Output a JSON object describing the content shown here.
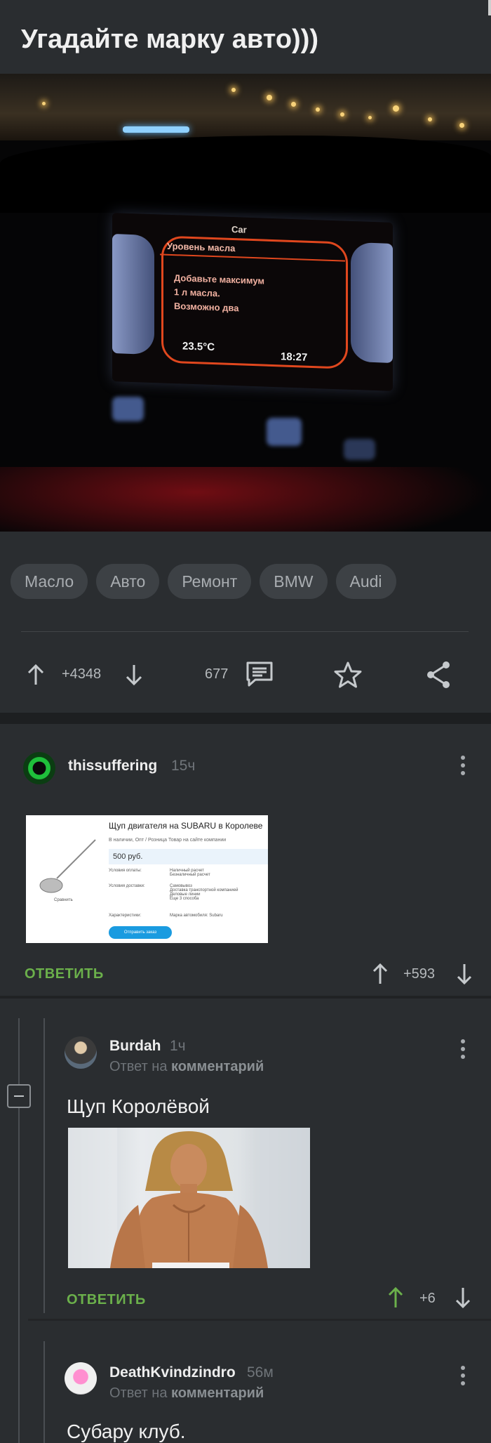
{
  "post": {
    "title": "Угадайте марку авто)))",
    "photo": {
      "screen_title": "Car",
      "screen_header": "Уровень масла",
      "screen_message_1": "Добавьте максимум",
      "screen_message_2": "1 л масла.",
      "screen_message_3": "Возможно два",
      "temperature": "23.5°C",
      "clock": "18:27"
    },
    "tags": [
      "Масло",
      "Авто",
      "Ремонт",
      "BMW",
      "Audi"
    ],
    "rating": "+4348",
    "comments_count": "677"
  },
  "comments": [
    {
      "author": "thissuffering",
      "time": "15ч",
      "attachment": {
        "title": "Щуп двигателя на SUBARU в Королеве",
        "subline": "В наличии, Опт / Розница      Товар на сайте компании",
        "price": "500 руб.",
        "rows": [
          [
            "Условия оплаты:",
            "Наличный расчет\nБезналичный расчет"
          ],
          [
            "Условия доставки:",
            "Самовывоз\nДоставка транспортной компанией\nДеловые линии\nЕще 3 способа"
          ],
          [
            "Характеристики:",
            "Марка автомобиля: Subaru"
          ]
        ],
        "compare": "Сравнить",
        "order_button": "Отправить заказ"
      },
      "reply_label": "ОТВЕТИТЬ",
      "rating": "+593"
    },
    {
      "author": "Burdah",
      "time": "1ч",
      "reply_to_prefix": "Ответ на",
      "reply_to_target": "комментарий",
      "text": "Щуп Королёвой",
      "reply_label": "ОТВЕТИТЬ",
      "rating": "+6"
    },
    {
      "author": "DeathKvindzindro",
      "time": "56м",
      "reply_to_prefix": "Ответ на",
      "reply_to_target": "комментарий",
      "text": "Субару клуб."
    }
  ],
  "colors": {
    "background": "#2a2d30",
    "reply_green": "#6bb04b",
    "upvote_green": "#6bb04b",
    "screen_orange": "#e0471e"
  },
  "icons": [
    "arrow-up-icon",
    "arrow-down-icon",
    "comment-icon",
    "star-icon",
    "share-icon",
    "more-vertical-icon",
    "collapse-icon"
  ]
}
